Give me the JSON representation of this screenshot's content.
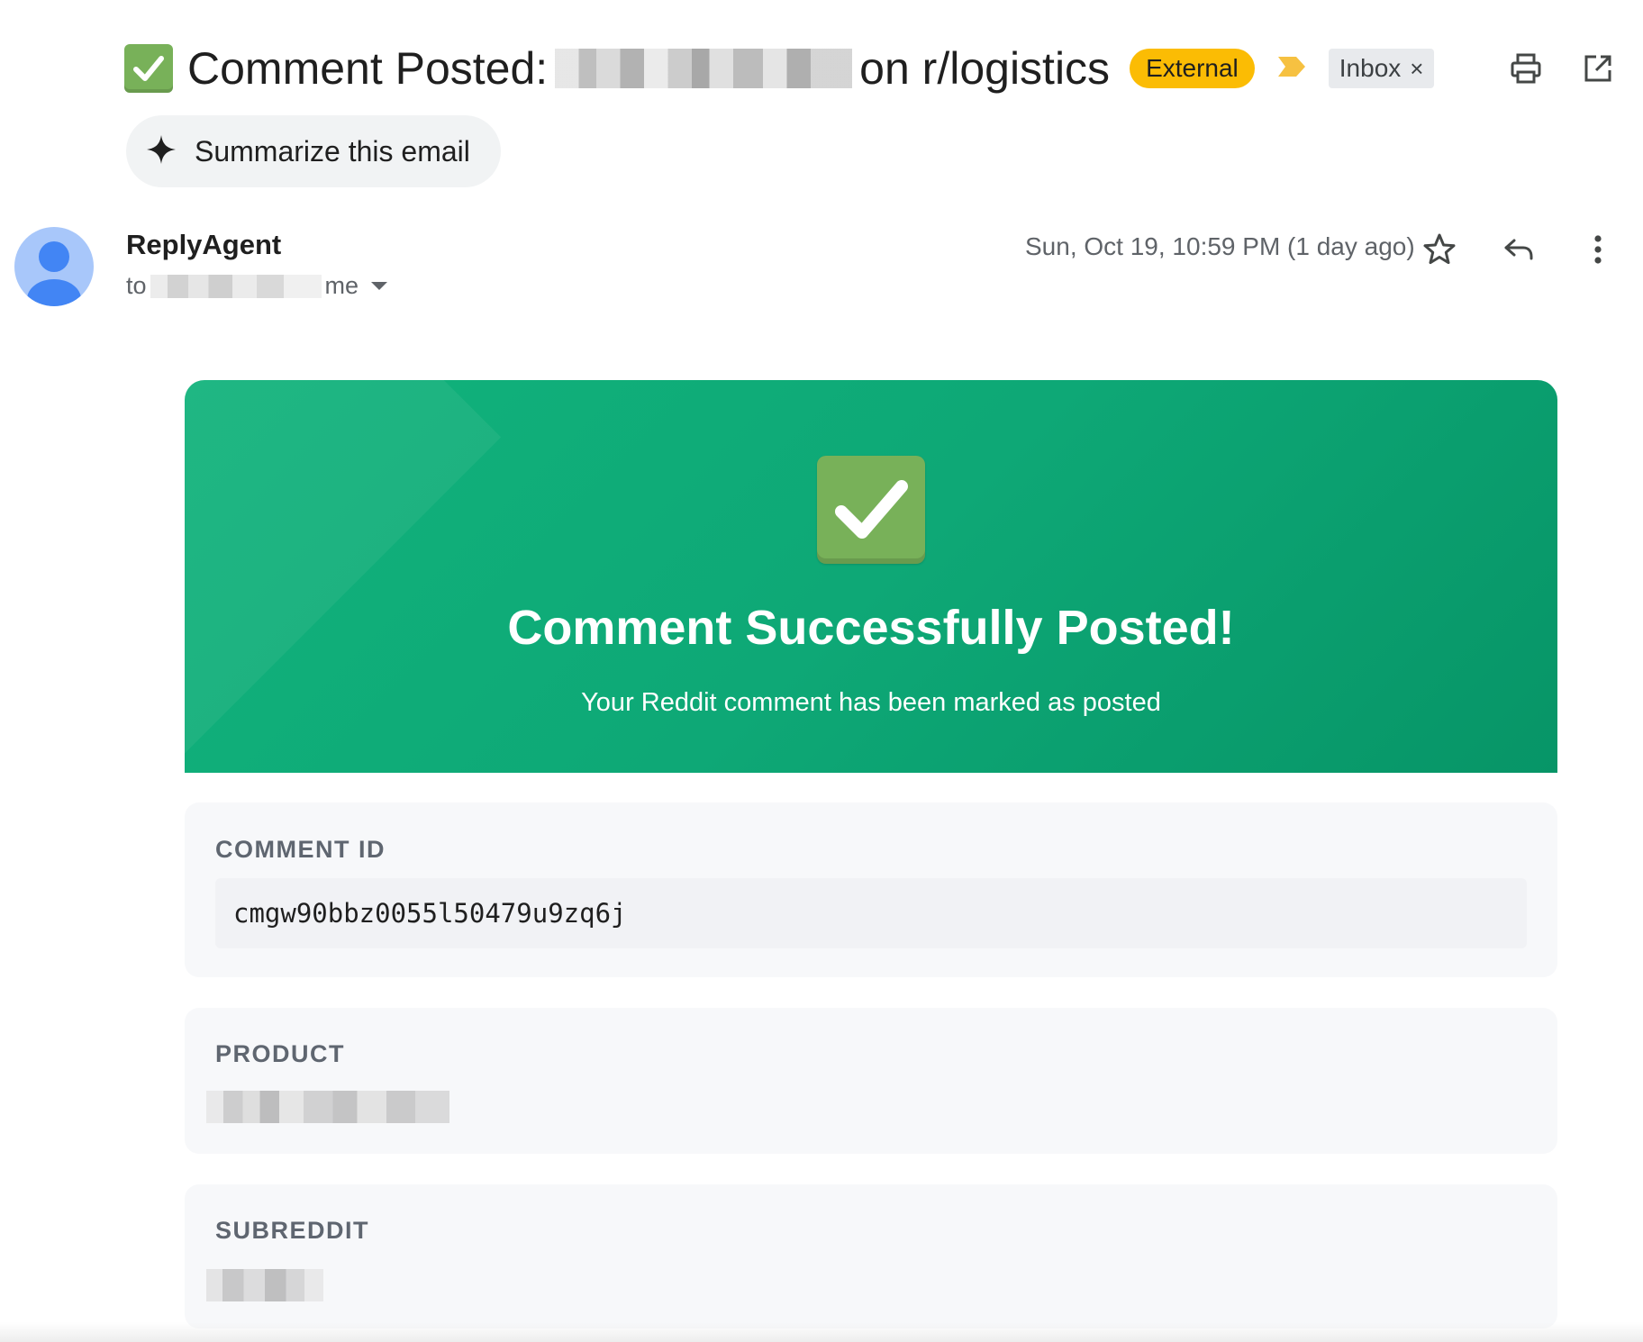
{
  "subject": {
    "prefix": "Comment Posted:",
    "suffix": "on r/logistics",
    "label_external": "External",
    "label_inbox": "Inbox",
    "inbox_remove": "×"
  },
  "summarize_label": "Summarize this email",
  "sender": {
    "name": "ReplyAgent",
    "to_prefix": "to",
    "to_suffix": "me",
    "date": "Sun, Oct 19, 10:59 PM (1 day ago)"
  },
  "hero": {
    "title": "Comment Successfully Posted!",
    "subtitle": "Your Reddit comment has been marked as posted"
  },
  "fields": {
    "comment_id_label": "COMMENT ID",
    "comment_id_value": "cmgw90bbz0055l50479u9zq6j",
    "product_label": "PRODUCT",
    "subreddit_label": "SUBREDDIT"
  },
  "icons": {
    "subject_check": "check-mark-button-icon",
    "importance": "importance-marker-icon",
    "print": "print-icon",
    "open_new_window": "open-in-new-window-icon",
    "sparkle": "sparkle-icon",
    "avatar": "person-avatar-icon",
    "star": "star-icon",
    "reply": "reply-icon",
    "more": "more-vertical-icon",
    "hero_check": "check-mark-button-icon"
  },
  "colors": {
    "accent_green": "#0ea876",
    "external_badge": "#fbbc04",
    "importance_marker": "#f6c141",
    "avatar_bg": "#a8c7fa",
    "avatar_fg": "#4285f4"
  }
}
